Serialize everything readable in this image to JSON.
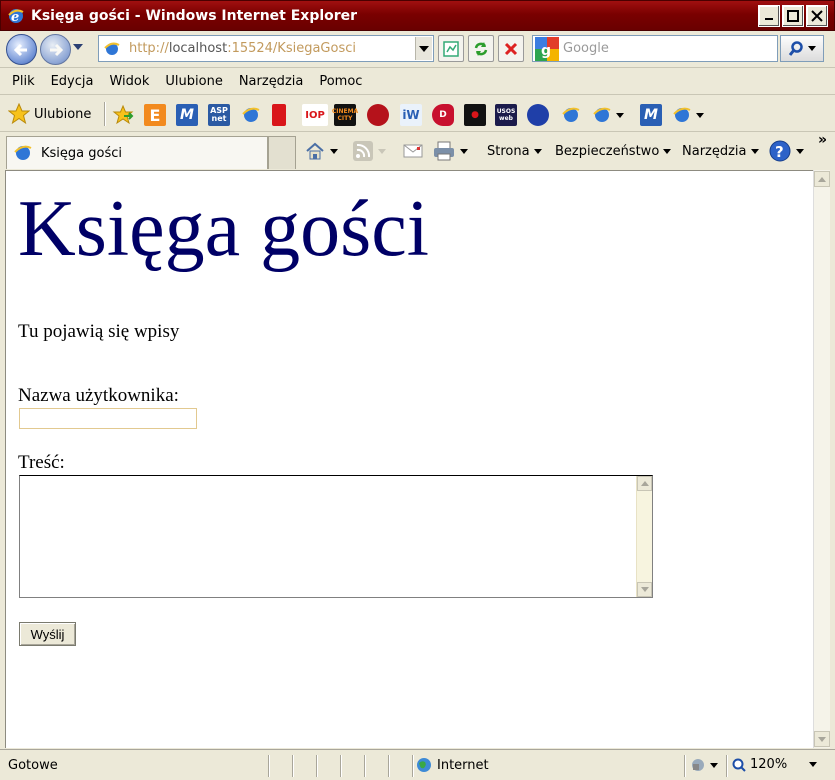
{
  "window": {
    "title": "Księga gości - Windows Internet Explorer"
  },
  "address": {
    "url_prefix": "http://",
    "url_host": "localhost",
    "url_rest": ":15524/KsiegaGosci"
  },
  "search": {
    "placeholder": "Google"
  },
  "menu": {
    "items": [
      "Plik",
      "Edycja",
      "Widok",
      "Ulubione",
      "Narzędzia",
      "Pomoc"
    ]
  },
  "favorites": {
    "label": "Ulubione",
    "icons": [
      "blogger-e",
      "m-icon",
      "aspnet",
      "ie-page",
      "red-bookmark",
      "iop",
      "cinema-city",
      "shield",
      "iw",
      "red-d",
      "pacman",
      "usos-web",
      "sonic",
      "ie-page",
      "ie-page",
      "m-icon",
      "ie-page"
    ]
  },
  "tab": {
    "title": "Księga gości"
  },
  "commands": {
    "page": "Strona",
    "security": "Bezpieczeństwo",
    "tools": "Narzędzia"
  },
  "page": {
    "heading": "Księga gości",
    "entries_note": "Tu pojawią się wpisy",
    "username_label": "Nazwa użytkownika:",
    "username_value": "",
    "content_label": "Treść:",
    "content_value": "",
    "submit_label": "Wyślij"
  },
  "status": {
    "text": "Gotowe",
    "zone": "Internet",
    "zoom": "120%"
  }
}
